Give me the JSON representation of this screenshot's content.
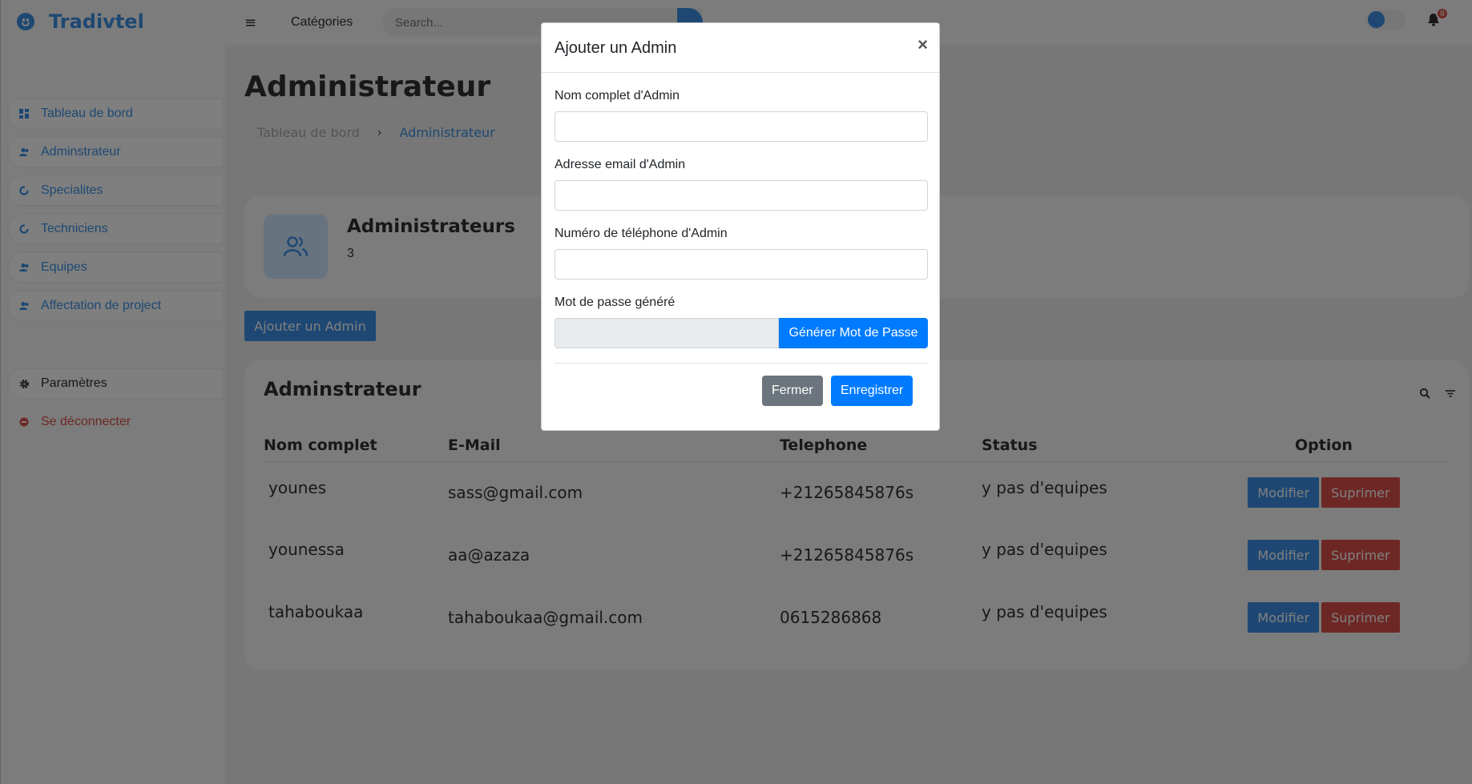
{
  "brand": {
    "name": "Tradivtel",
    "icon": "smile-icon"
  },
  "sidebar": {
    "items": [
      {
        "label": "Tableau de bord",
        "icon": "dashboard-icon"
      },
      {
        "label": "Adminstrateur",
        "icon": "users-icon"
      },
      {
        "label": "Specialites",
        "icon": "pie-icon"
      },
      {
        "label": "Techniciens",
        "icon": "pie-icon"
      },
      {
        "label": "Equipes",
        "icon": "users-icon"
      },
      {
        "label": "Affectation de project",
        "icon": "users-icon"
      }
    ],
    "settings": {
      "label": "Paramètres",
      "icon": "gear-icon"
    },
    "logout": {
      "label": "Se déconnecter",
      "icon": "logout-icon"
    }
  },
  "navbar": {
    "categories": "Catégories",
    "search_placeholder": "Search...",
    "notification_count": "8"
  },
  "page": {
    "title": "Administrateur",
    "breadcrumb": [
      "Tableau de bord",
      "Administrateur"
    ]
  },
  "stats": {
    "title": "Administrateurs",
    "value": "3"
  },
  "add_button": "Ajouter un Admin",
  "table": {
    "title": "Adminstrateur",
    "headers": [
      "Nom complet",
      "E-Mail",
      "Telephone",
      "Status",
      "Option"
    ],
    "rows": [
      {
        "name": "younes",
        "email": "sass@gmail.com",
        "phone": "+21265845876s",
        "status": "y pas d'equipes"
      },
      {
        "name": "younessa",
        "email": "aa@azaza",
        "phone": "+21265845876s",
        "status": "y pas d'equipes"
      },
      {
        "name": "tahaboukaa",
        "email": "tahaboukaa@gmail.com",
        "phone": "0615286868",
        "status": "y pas d'equipes"
      }
    ],
    "edit_label": "Modifier",
    "delete_label": "Suprimer"
  },
  "modal": {
    "title": "Ajouter un Admin",
    "close": "×",
    "fields": {
      "name_label": "Nom complet d'Admin",
      "email_label": "Adresse email d'Admin",
      "phone_label": "Numéro de téléphone d'Admin",
      "password_label": "Mot de passe généré"
    },
    "generate_label": "Générer Mot de Passe",
    "cancel_label": "Fermer",
    "save_label": "Enregistrer"
  },
  "colors": {
    "accent": "#3c91e6",
    "danger": "#db504a",
    "primary": "#007bff",
    "secondary": "#6c757d"
  }
}
